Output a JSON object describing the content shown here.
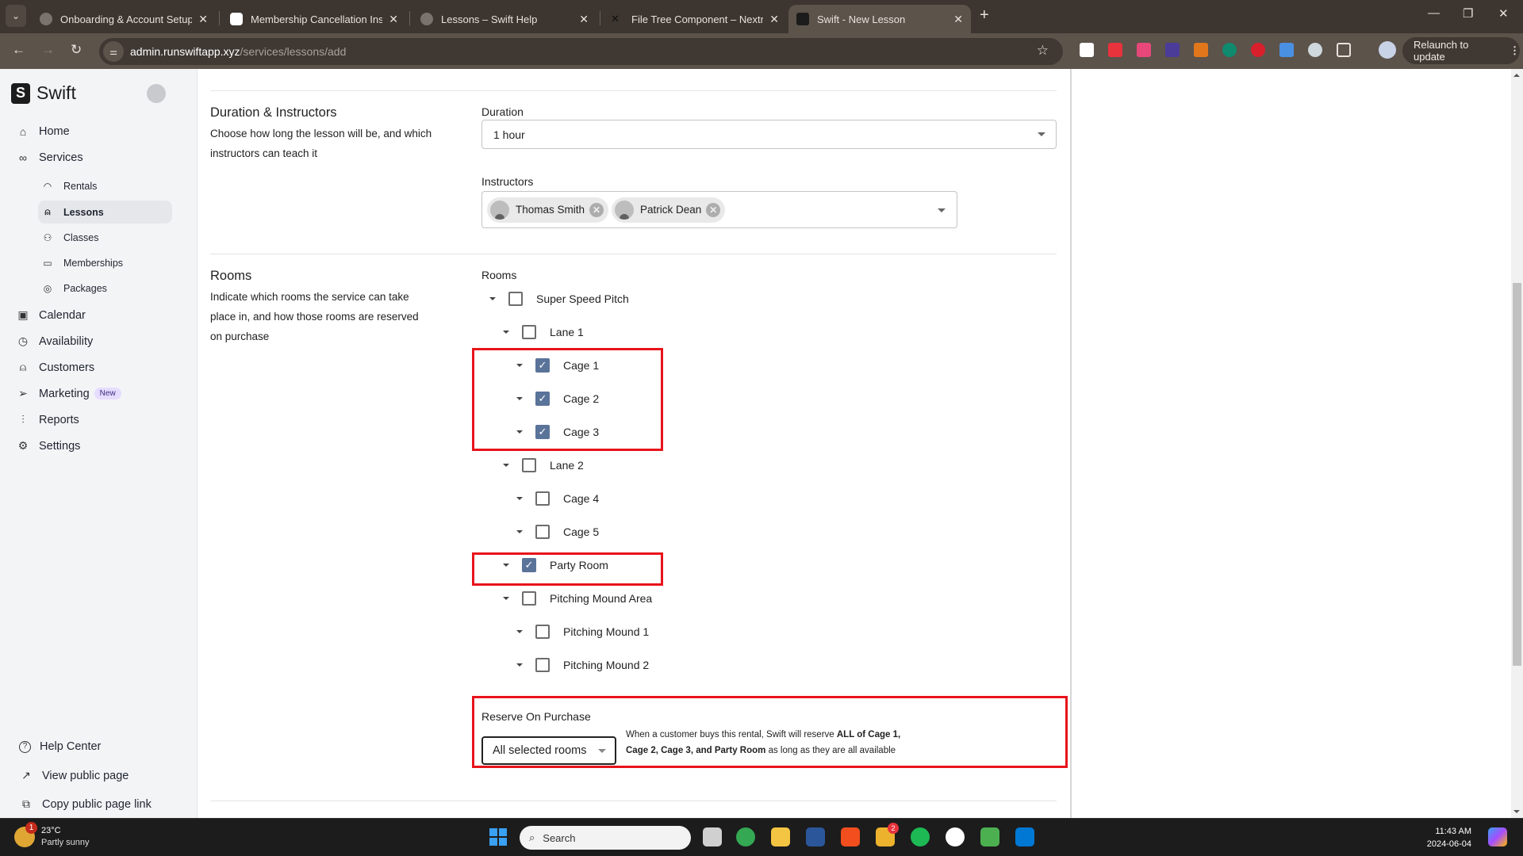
{
  "browser": {
    "tabs": [
      {
        "title": "Onboarding & Account Setup –",
        "favicon": "globe-icon",
        "active": false
      },
      {
        "title": "Membership Cancellation Instru",
        "favicon": "chatgpt-icon",
        "active": false
      },
      {
        "title": "Lessons – Swift Help",
        "favicon": "globe-icon",
        "active": false
      },
      {
        "title": "File Tree Component – Nextra",
        "favicon": "nextra-icon",
        "active": false
      },
      {
        "title": "Swift - New Lesson",
        "favicon": "swift-icon",
        "active": true
      }
    ],
    "close_glyph": "✕",
    "new_tab_glyph": "+",
    "url_host": "admin.runswiftapp.xyz",
    "url_path": "/services/lessons/add",
    "relaunch_label": "Relaunch to update",
    "extensions": [
      {
        "name": "mcafee-extension-icon",
        "color": "#ffffff"
      },
      {
        "name": "tp-extension-icon",
        "color": "#e8323c"
      },
      {
        "name": "puzzle-pink-extension-icon",
        "color": "#e8477a"
      },
      {
        "name": "printer-extension-icon",
        "color": "#4b3c9a"
      },
      {
        "name": "metamask-extension-icon",
        "color": "#e2761b"
      },
      {
        "name": "grammarly-extension-icon",
        "color": "#0f8a6e"
      },
      {
        "name": "adblock-plus-extension-icon",
        "color": "#d8202c"
      },
      {
        "name": "blue-square-extension-icon",
        "color": "#4a90e2"
      },
      {
        "name": "lock-extension-icon",
        "color": "#cfd8dc"
      },
      {
        "name": "extensions-puzzle-icon",
        "color": "#e8e2dc"
      }
    ]
  },
  "sidebar": {
    "brand": "Swift",
    "brand_mark": "S",
    "items": [
      {
        "label": "Home",
        "icon": "home-icon",
        "glyph": "⌂"
      },
      {
        "label": "Services",
        "icon": "link-icon",
        "glyph": "🔗"
      }
    ],
    "sub_items": [
      {
        "label": "Rentals",
        "icon": "gauge-icon",
        "glyph": "◠",
        "active": false
      },
      {
        "label": "Lessons",
        "icon": "user-icon",
        "glyph": "⍝",
        "active": true
      },
      {
        "label": "Classes",
        "icon": "users-icon",
        "glyph": "⚇",
        "active": false
      },
      {
        "label": "Memberships",
        "icon": "card-icon",
        "glyph": "▭",
        "active": false
      },
      {
        "label": "Packages",
        "icon": "coins-icon",
        "glyph": "◎",
        "active": false
      }
    ],
    "items_after": [
      {
        "label": "Calendar",
        "icon": "calendar-icon",
        "glyph": "▣"
      },
      {
        "label": "Availability",
        "icon": "clock-icon",
        "glyph": "◷"
      },
      {
        "label": "Customers",
        "icon": "user-icon",
        "glyph": "⍝"
      },
      {
        "label": "Marketing",
        "icon": "send-icon",
        "glyph": "➢",
        "badge": "New"
      },
      {
        "label": "Reports",
        "icon": "bar-chart-icon",
        "glyph": "▮"
      },
      {
        "label": "Settings",
        "icon": "gear-icon",
        "glyph": "⚙"
      }
    ],
    "footer": [
      {
        "label": "Help Center",
        "icon": "help-circle-icon",
        "glyph": "?"
      },
      {
        "label": "View public page",
        "icon": "external-link-icon",
        "glyph": "↗"
      },
      {
        "label": "Copy public page link",
        "icon": "copy-icon",
        "glyph": "⧉"
      }
    ]
  },
  "duration_section": {
    "title": "Duration & Instructors",
    "description": "Choose how long the lesson will be, and which instructors can teach it",
    "duration_label": "Duration",
    "duration_value": "1 hour",
    "instructors_label": "Instructors",
    "instructors": [
      "Thomas Smith",
      "Patrick Dean"
    ]
  },
  "rooms_section": {
    "title": "Rooms",
    "description": "Indicate which rooms the service can take place in, and how those rooms are reserved on purchase",
    "rooms_label": "Rooms",
    "tree": [
      {
        "label": "Super Speed Pitch",
        "level": 0,
        "checked": false
      },
      {
        "label": "Lane 1",
        "level": 1,
        "checked": false
      },
      {
        "label": "Cage 1",
        "level": 2,
        "checked": true
      },
      {
        "label": "Cage 2",
        "level": 2,
        "checked": true
      },
      {
        "label": "Cage 3",
        "level": 2,
        "checked": true
      },
      {
        "label": "Lane 2",
        "level": 1,
        "checked": false
      },
      {
        "label": "Cage 4",
        "level": 2,
        "checked": false
      },
      {
        "label": "Cage 5",
        "level": 2,
        "checked": false
      },
      {
        "label": "Party Room",
        "level": 1,
        "checked": true
      },
      {
        "label": "Pitching Mound Area",
        "level": 1,
        "checked": false
      },
      {
        "label": "Pitching Mound 1",
        "level": 2,
        "checked": false
      },
      {
        "label": "Pitching Mound 2",
        "level": 2,
        "checked": false
      }
    ],
    "reserve_label": "Reserve On Purchase",
    "reserve_value": "All selected rooms",
    "reserve_note_prefix": "When a customer buys this rental, Swift will reserve ",
    "reserve_note_bold1": "ALL of Cage 1, Cage 2, Cage 3, and Party Room",
    "reserve_note_suffix": " as long as they are all available",
    "highlight_color": "#e8141b",
    "checkbox_color": "#5a7399"
  },
  "taskbar": {
    "weather_temp": "23°C",
    "weather_desc": "Partly sunny",
    "weather_badge": "1",
    "search_placeholder": "Search",
    "time": "11:43 AM",
    "date": "2024-06-04",
    "apps": [
      {
        "name": "task-view-icon",
        "color": "#d0d0d0"
      },
      {
        "name": "chrome-icon",
        "color": "#34a853"
      },
      {
        "name": "file-explorer-icon",
        "color": "#f4c542"
      },
      {
        "name": "word-icon",
        "color": "#2b579a"
      },
      {
        "name": "figma-icon",
        "color": "#f24e1e"
      },
      {
        "name": "slack-icon",
        "color": "#ecb22e",
        "badge": "2"
      },
      {
        "name": "spotify-icon",
        "color": "#1db954"
      },
      {
        "name": "monday-icon",
        "color": "#ffffff"
      },
      {
        "name": "sourcetree-icon",
        "color": "#4caf50"
      },
      {
        "name": "vscode-icon",
        "color": "#0078d4"
      }
    ]
  }
}
